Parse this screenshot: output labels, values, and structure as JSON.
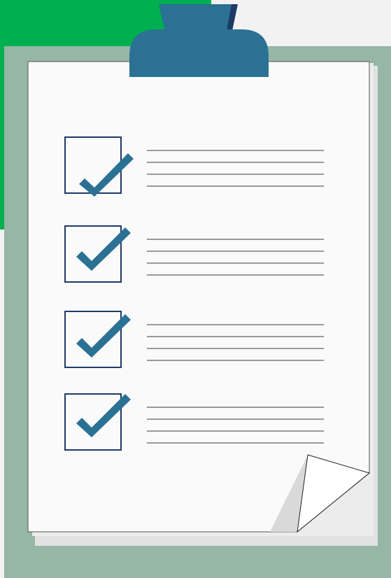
{
  "colors": {
    "green_accent": "#00b050",
    "board": "#96b6a6",
    "clip": "#2b7194",
    "clip_dark": "#1e3a66",
    "paper": "#fafafa",
    "check": "#2b7194",
    "box_border": "#1e3a66",
    "line": "#3a3a3a"
  },
  "checklist": {
    "items": [
      {
        "checked": true,
        "lines": 4
      },
      {
        "checked": true,
        "lines": 4
      },
      {
        "checked": true,
        "lines": 4
      },
      {
        "checked": true,
        "lines": 4
      }
    ]
  }
}
